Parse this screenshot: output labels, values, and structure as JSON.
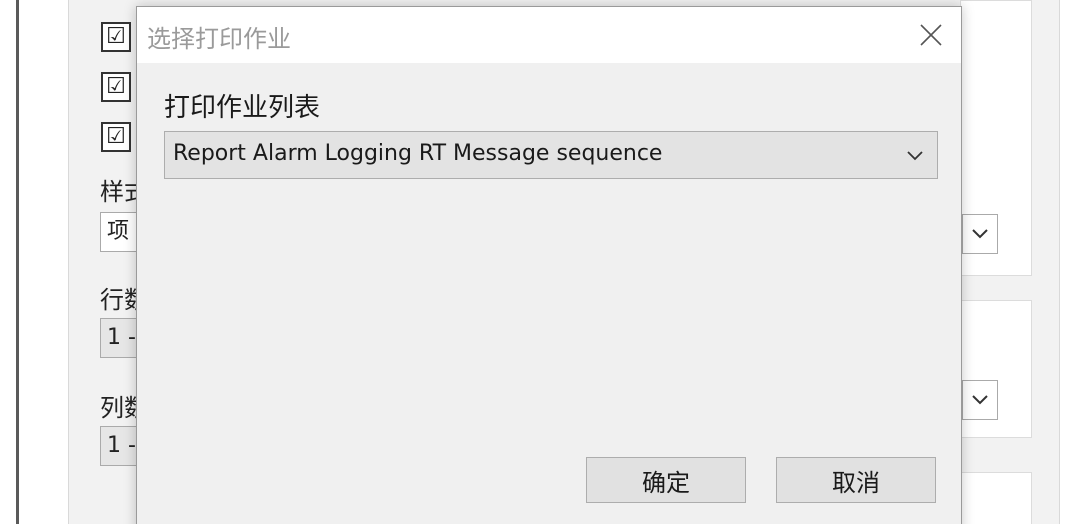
{
  "background_window": {
    "checkbox_mark": "☑",
    "labels": [
      "样式",
      "行数",
      "列数"
    ],
    "fields": [
      "项",
      "1 -",
      "1 -"
    ]
  },
  "dialog": {
    "title": "选择打印作业",
    "close_glyph": "✕",
    "list_label": "打印作业列表",
    "selected_job": "Report Alarm Logging RT Message sequence",
    "ok_label": "确定",
    "cancel_label": "取消"
  },
  "colors": {
    "dialog_background": "#f0f0f0",
    "title_text": "#9a9a9a",
    "button_face": "#e1e1e1",
    "combo_face": "#e3e3e3"
  },
  "icons": {
    "close": "close-icon",
    "dropdown": "chevron-down-icon",
    "checkbox": "checkbox-checked-icon"
  }
}
